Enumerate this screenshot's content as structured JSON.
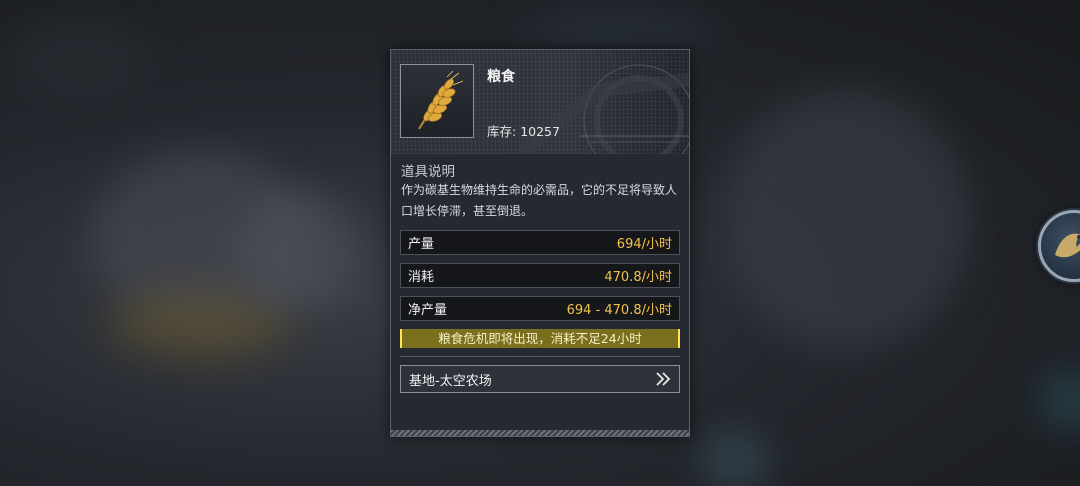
{
  "item": {
    "name": "粮食",
    "stock_label": "库存:",
    "stock_value": "10257",
    "icon": "wheat-icon"
  },
  "description": {
    "title": "道具说明",
    "text": "作为碳基生物维持生命的必需品，它的不足将导致人口增长停滞，甚至倒退。"
  },
  "stats": [
    {
      "label": "产量",
      "value": "694/小时"
    },
    {
      "label": "消耗",
      "value": "470.8/小时"
    },
    {
      "label": "净产量",
      "value": "694 - 470.8/小时"
    }
  ],
  "warning": "粮食危机即将出现，消耗不足24小时",
  "source_link": {
    "label": "基地-太空农场",
    "icon": "double-chevron-right-icon"
  },
  "side_button": {
    "icon": "bird-emblem-icon"
  },
  "colors": {
    "accent_value": "#f2c24a",
    "warning_bg": "#7a6f1d",
    "warning_border": "#ffe45a"
  }
}
